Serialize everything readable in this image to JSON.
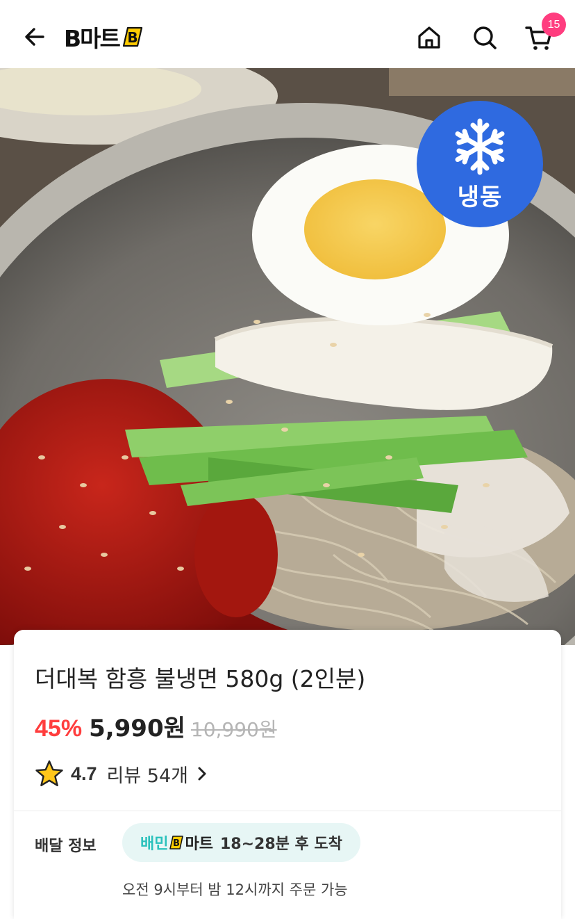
{
  "header": {
    "logo_text": "B마트",
    "cart_count": "15"
  },
  "hero": {
    "frozen_label": "냉동"
  },
  "product": {
    "title": "더대복 함흥 불냉면 580g (2인분)",
    "discount": "45%",
    "price": "5,990원",
    "original_price": "10,990원",
    "rating": "4.7",
    "review_text": "리뷰 54개"
  },
  "delivery": {
    "label": "배달 정보",
    "brand_part1": "배민",
    "brand_part2": "마트",
    "time": "18~28분 후 도착",
    "hours": "오전 9시부터 밤 12시까지 주문 가능"
  },
  "colors": {
    "accent_red": "#ff3d3d",
    "badge_pink": "#ff3d7f",
    "frozen_blue": "#2f6ae0",
    "baemin_mint": "#2ac1bc",
    "logo_yellow": "#ffcc00"
  },
  "icons": [
    "back-arrow-icon",
    "home-icon",
    "search-icon",
    "cart-icon",
    "snowflake-icon",
    "star-icon",
    "chevron-right-icon"
  ]
}
